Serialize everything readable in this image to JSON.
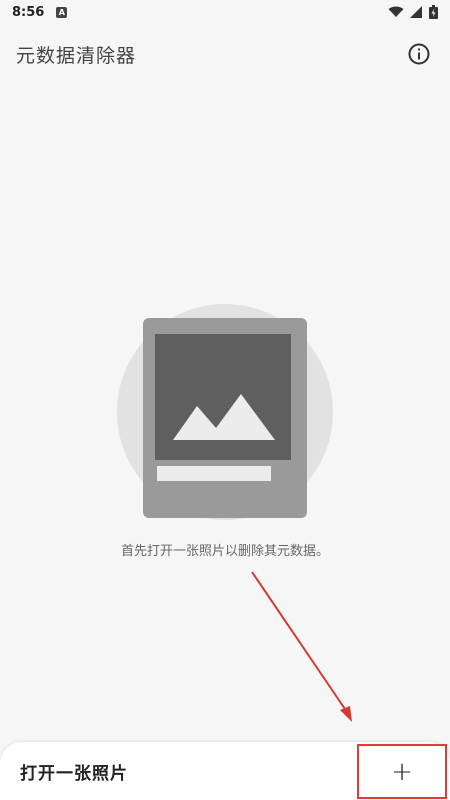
{
  "status_bar": {
    "time": "8:56",
    "notification_icon": "a-icon",
    "right_icons": [
      "wifi-icon",
      "signal-icon",
      "battery-icon"
    ]
  },
  "app_bar": {
    "title": "元数据清除器",
    "info_icon": "info-icon"
  },
  "main": {
    "illustration_icon": "photo-placeholder-icon",
    "hint": "首先打开一张照片以删除其元数据。"
  },
  "bottom_bar": {
    "label": "打开一张照片",
    "add_label": "+"
  },
  "colors": {
    "background": "#f6f6f6",
    "highlight_red": "#e23b3b",
    "arrow_red": "#d33b32"
  }
}
